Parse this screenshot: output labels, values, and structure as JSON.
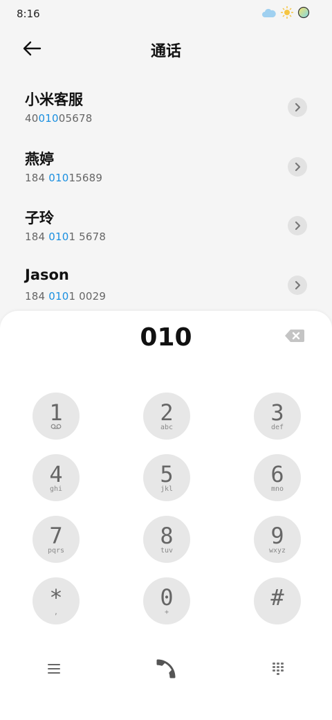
{
  "status": {
    "time": "8:16"
  },
  "header": {
    "title": "通话"
  },
  "contacts": [
    {
      "name": "小米客服",
      "pre": "40",
      "hl": "010",
      "post": "05678"
    },
    {
      "name": "燕婷",
      "pre": "184 ",
      "hl": "010",
      "post": "15689"
    },
    {
      "name": "子玲",
      "pre": "184 ",
      "hl": "010",
      "post": "1 5678"
    },
    {
      "name": "Jason",
      "pre": "184 ",
      "hl": "010",
      "post": "1 0029"
    }
  ],
  "dialer": {
    "number": "010",
    "keys": [
      {
        "digit": "1",
        "letters": "ꝏ"
      },
      {
        "digit": "2",
        "letters": "abc"
      },
      {
        "digit": "3",
        "letters": "def"
      },
      {
        "digit": "4",
        "letters": "ghi"
      },
      {
        "digit": "5",
        "letters": "jkl"
      },
      {
        "digit": "6",
        "letters": "mno"
      },
      {
        "digit": "7",
        "letters": "pqrs"
      },
      {
        "digit": "8",
        "letters": "tuv"
      },
      {
        "digit": "9",
        "letters": "wxyz"
      },
      {
        "digit": "*",
        "letters": ","
      },
      {
        "digit": "0",
        "letters": "+"
      },
      {
        "digit": "#",
        "letters": ""
      }
    ]
  },
  "colors": {
    "accent": "#1a8fe0",
    "key_bg": "#e7e7e7",
    "page_bg": "#f5f5f5"
  },
  "icons": {
    "back": "back-arrow-icon",
    "chevron": "chevron-right-icon",
    "backspace": "backspace-icon",
    "menu": "menu-icon",
    "call": "phone-icon",
    "keypad": "dialpad-icon"
  }
}
